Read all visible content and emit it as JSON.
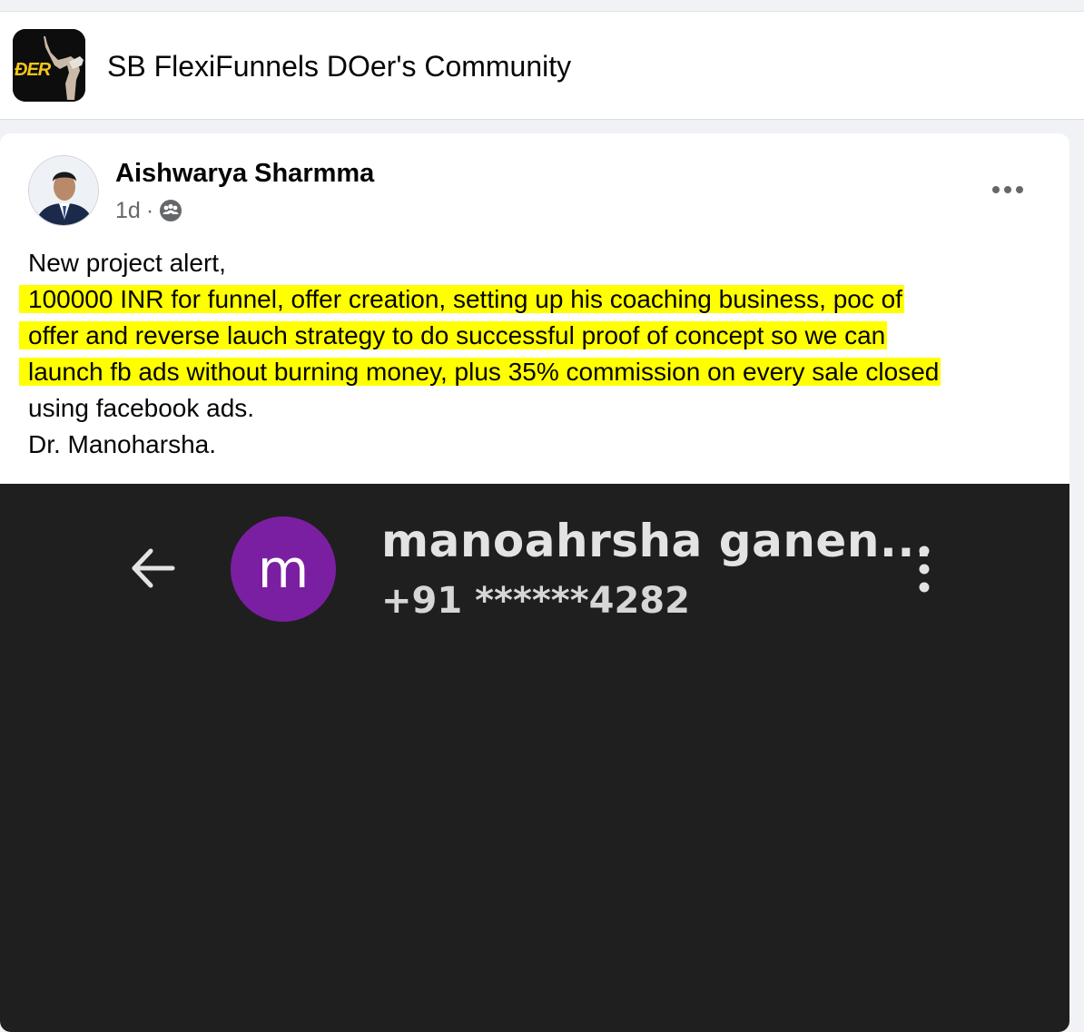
{
  "group": {
    "name": "SB FlexiFunnels DOer's Community",
    "logo_text": "ÐER"
  },
  "post": {
    "author": "Aishwarya Sharmma",
    "time": "1d",
    "separator": "·",
    "audience_icon": "group-icon",
    "more_icon": "ellipsis-icon",
    "lines": [
      {
        "text": "New project alert,",
        "highlight": false
      },
      {
        "text": "100000 INR for funnel, offer creation, setting up his coaching business, poc of",
        "highlight": true
      },
      {
        "text": "offer and reverse lauch strategy to do successful proof of concept so we can",
        "highlight": true
      },
      {
        "text": "launch fb ads without burning money, plus 35% commission on every sale closed",
        "highlight": true
      },
      {
        "text": "using facebook ads.",
        "highlight": false
      },
      {
        "text": "Dr. Manoharsha.",
        "highlight": false
      }
    ]
  },
  "attachment": {
    "back_icon": "back-arrow-icon",
    "contact_initial": "m",
    "contact_name": "manoahrsha ganen...",
    "contact_phone": "+91 ******4282",
    "menu_icon": "more-vertical-icon",
    "colors": {
      "background": "#1f1f1f",
      "avatar": "#7b1fa2"
    }
  },
  "colors": {
    "highlight": "#ffff00",
    "page_bg": "#f0f2f5",
    "card_bg": "#ffffff"
  }
}
